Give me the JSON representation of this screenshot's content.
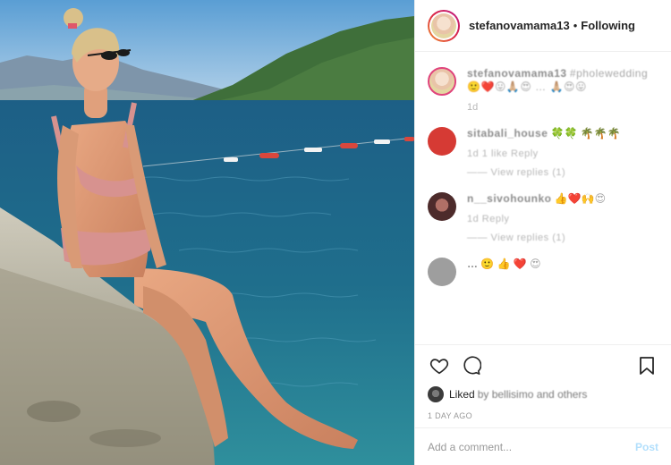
{
  "post": {
    "username": "stefanovamama13",
    "separator": "•",
    "follow_status": "Following"
  },
  "comments": [
    {
      "name": "stefanovamama13",
      "text": "#pholewedding 🙂❤️😛🙏🏼😍 … 🙏🏼😍😛",
      "meta": "1d",
      "type": "caption"
    },
    {
      "name": "sitabali_house",
      "text": "🍀🍀 🌴🌴🌴",
      "meta": "1d  1 like  Reply",
      "replies": "—— View replies (1)"
    },
    {
      "name": "n__sivohounko",
      "text": "👍❤️🙌😍",
      "meta": "1d  Reply",
      "replies": "—— View replies (1)"
    },
    {
      "name": "…",
      "text": "🙂 👍 ❤️ 😍",
      "meta": "",
      "replies": ""
    }
  ],
  "likes": {
    "prefix": "Liked",
    "by": "by bellisimo and others"
  },
  "timestamp": "1 DAY AGO",
  "comment_input": {
    "placeholder": "Add a comment...",
    "post_label": "Post"
  },
  "icons": [
    "heart-icon",
    "comment-icon",
    "bookmark-icon"
  ],
  "colors": {
    "border": "#efefef",
    "story_ring_start": "#f09433",
    "story_ring_end": "#bc1888",
    "post_button": "#b2dffc"
  }
}
